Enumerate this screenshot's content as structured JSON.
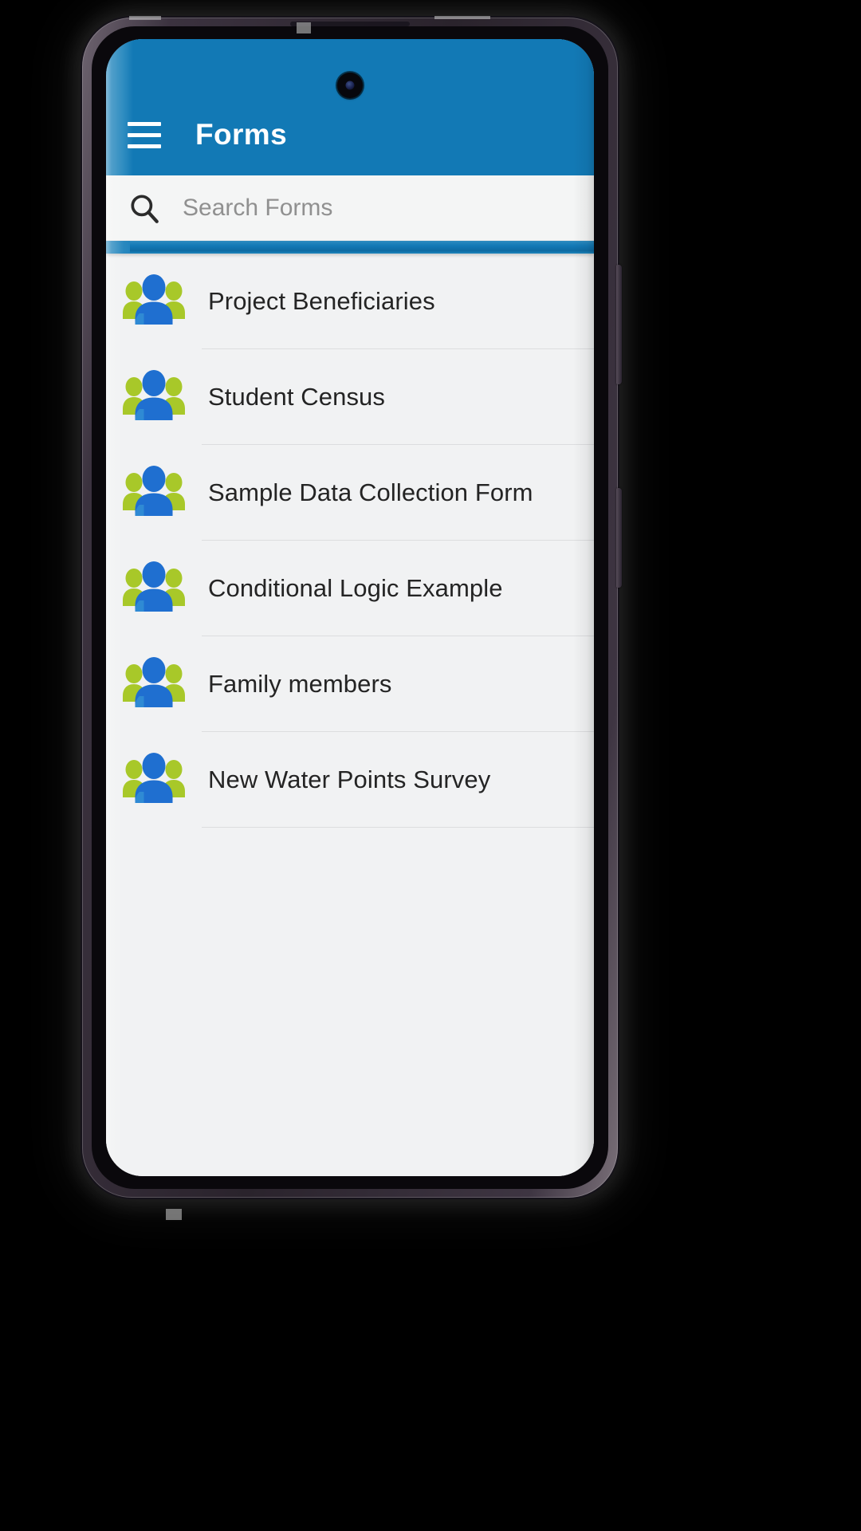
{
  "app": {
    "title": "Forms",
    "accent_color": "#1279b5",
    "accent_light_color": "#2e8cc0",
    "screen_background": "#f1f2f3",
    "search_background": "#f4f5f5",
    "divider_color": "#dcdddf",
    "label_color": "#242424",
    "placeholder_color": "#909090"
  },
  "app_bar": {
    "title": "Forms",
    "menu_icon": "hamburger-menu-icon"
  },
  "search": {
    "icon": "search-icon",
    "value": "",
    "placeholder": "Search Forms"
  },
  "progress_bar": {
    "visible": true,
    "color": "#1379b6"
  },
  "forms": {
    "row_icon": "group-people-icon",
    "items": [
      {
        "label": "Project Beneficiaries"
      },
      {
        "label": "Student Census"
      },
      {
        "label": "Sample Data Collection Form"
      },
      {
        "label": "Conditional Logic Example"
      },
      {
        "label": "Family members"
      },
      {
        "label": "New Water Points Survey"
      }
    ]
  },
  "device": {
    "front_camera": "front-camera-icon",
    "volume_key": "volume-side-key",
    "power_key": "power-side-key"
  },
  "icon_colors": {
    "person_front": "#1f6fd0",
    "person_front_shade": "#2f8ad4",
    "person_side": "#a8c829",
    "person_side_dark": "#8fb520"
  }
}
